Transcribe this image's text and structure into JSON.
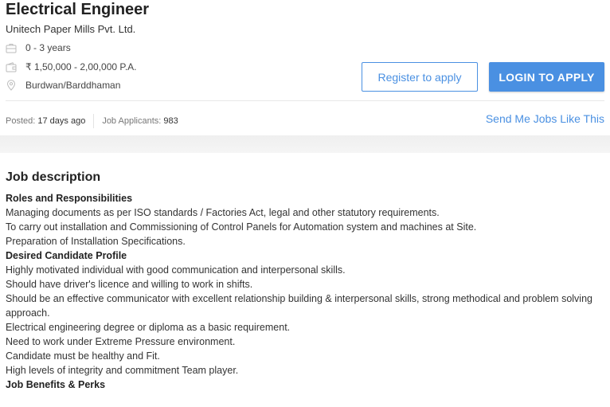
{
  "job": {
    "title": "Electrical Engineer",
    "company": "Unitech Paper Mills Pvt. Ltd.",
    "experience": "0 - 3 years",
    "salary": "₹ 1,50,000 - 2,00,000 P.A.",
    "location": "Burdwan/Barddhaman"
  },
  "icons": {
    "experience": "briefcase-icon",
    "salary": "wallet-icon",
    "location": "location-pin-icon"
  },
  "actions": {
    "register_label": "Register to apply",
    "login_label": "LOGIN TO APPLY"
  },
  "stats": {
    "posted_label": "Posted:",
    "posted_value": "17 days ago",
    "applicants_label": "Job Applicants:",
    "applicants_value": "983",
    "send_jobs_label": "Send Me Jobs Like This"
  },
  "description": {
    "heading": "Job description",
    "roles_heading": "Roles and Responsibilities",
    "roles": [
      "Managing documents as per ISO standards / Factories Act, legal and other statutory requirements.",
      "To carry out installation and Commissioning of Control Panels for Automation system and machines at Site.",
      "Preparation of Installation Specifications."
    ],
    "profile_heading": "Desired Candidate Profile",
    "profile": [
      "Highly motivated individual with good communication and interpersonal skills.",
      "Should have driver's licence and willing to work in shifts.",
      "Should be an effective communicator with excellent relationship building & interpersonal skills, strong methodical and problem solving approach.",
      "Electrical engineering degree or diploma as a basic requirement.",
      "Need to work under Extreme Pressure environment.",
      "Candidate must be healthy and Fit.",
      "High levels of integrity and commitment Team player."
    ],
    "benefits_heading": "Job Benefits & Perks"
  },
  "colors": {
    "accent": "#4a90e2",
    "text": "#333333",
    "muted": "#777777"
  }
}
